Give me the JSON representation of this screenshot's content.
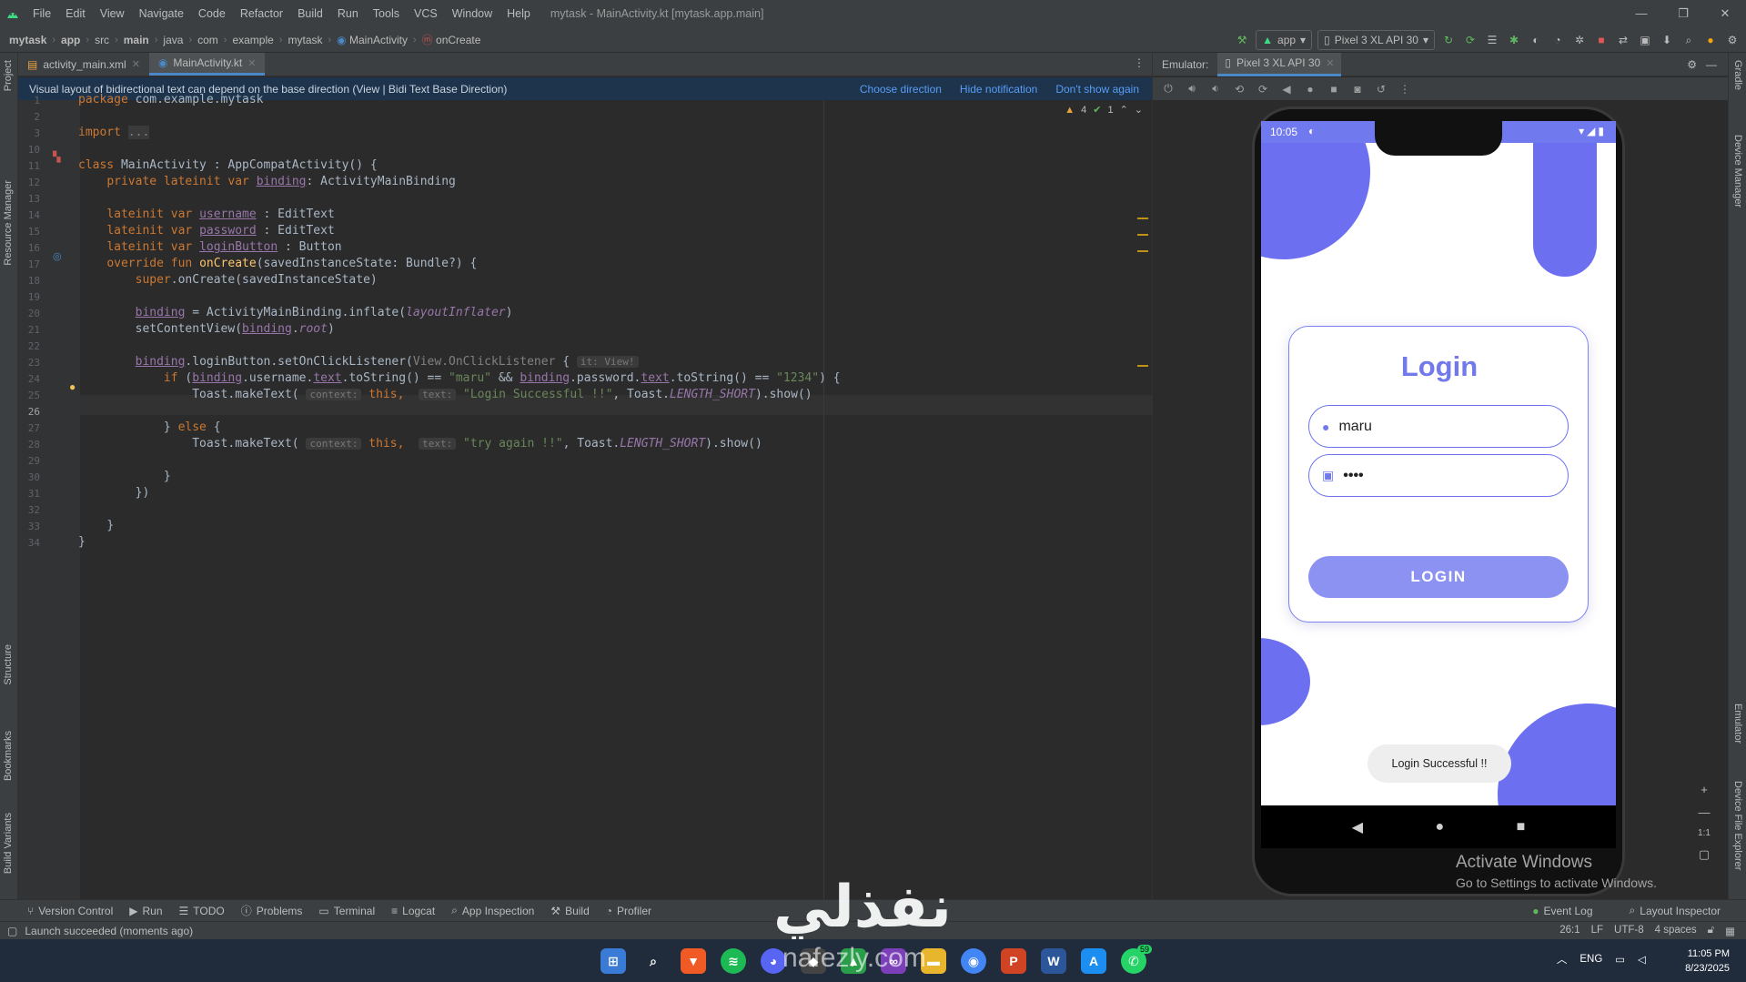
{
  "window": {
    "menu": [
      "File",
      "Edit",
      "View",
      "Navigate",
      "Code",
      "Refactor",
      "Build",
      "Run",
      "Tools",
      "VCS",
      "Window",
      "Help"
    ],
    "title": "mytask - MainActivity.kt [mytask.app.main]",
    "controls": [
      "—",
      "❐",
      "✕"
    ]
  },
  "breadcrumbs": [
    "mytask",
    "app",
    "src",
    "main",
    "java",
    "com",
    "example",
    "mytask",
    "MainActivity",
    "onCreate"
  ],
  "toolbar": {
    "run_config": "app",
    "device": "Pixel 3 XL API 30"
  },
  "left_strip": [
    "Project",
    "Resource Manager",
    "Structure",
    "Bookmarks",
    "Build Variants"
  ],
  "right_strip": [
    "Gradle",
    "Device Manager",
    "Emulator",
    "Device File Explorer"
  ],
  "tabs": [
    {
      "label": "activity_main.xml",
      "active": false
    },
    {
      "label": "MainActivity.kt",
      "active": true
    }
  ],
  "notification": {
    "text": "Visual layout of bidirectional text can depend on the base direction (View | Bidi Text Base Direction)",
    "links": [
      "Choose direction",
      "Hide notification",
      "Don't show again"
    ]
  },
  "inspections": {
    "warnings": "4",
    "ok": "1"
  },
  "code": {
    "line_numbers": [
      "1",
      "2",
      "3",
      "10",
      "11",
      "12",
      "13",
      "14",
      "15",
      "16",
      "17",
      "18",
      "19",
      "20",
      "21",
      "22",
      "23",
      "24",
      "25",
      "26",
      "27",
      "28",
      "29",
      "30",
      "31",
      "32",
      "33",
      "34"
    ],
    "l1a": "package",
    "l1b": " com.example.mytask",
    "l3a": "import",
    "l3b": "...",
    "l10a": "class",
    "l10b": " MainActivity : AppCompatActivity() {",
    "l11a": "private lateinit var",
    "l11b": "binding",
    "l11c": ": ActivityMainBinding",
    "l13a": "lateinit var",
    "l13b": "username",
    "l13c": " : EditText",
    "l14a": "lateinit var",
    "l14b": "password",
    "l14c": " : EditText",
    "l15a": "lateinit var",
    "l15b": "loginButton",
    "l15c": " : Button",
    "l16a": "override fun",
    "l16b": "onCreate",
    "l16c": "(savedInstanceState: Bundle?) {",
    "l17a": "super",
    "l17b": ".onCreate(savedInstanceState)",
    "l19a": "binding",
    "l19b": " = ActivityMainBinding.inflate(",
    "l19c": "layoutInflater",
    "l19d": ")",
    "l20a": "setContentView(",
    "l20b": "binding",
    "l20c": ".",
    "l20d": "root",
    "l20e": ")",
    "l22a": "binding",
    "l22b": ".loginButton.setOnClickListener(",
    "l22c": "View.OnClickListener",
    "l22d": " { ",
    "l22e": "it: View!",
    "l23a": "if",
    "l23b": " (",
    "l23c": "binding",
    "l23d": ".username.",
    "l23e": "text",
    "l23f": ".toString() == ",
    "l23g": "\"maru\"",
    "l23h": " && ",
    "l23i": "binding",
    "l23j": ".password.",
    "l23k": "text",
    "l23l": ".toString() == ",
    "l23m": "\"1234\"",
    "l23n": ") {",
    "l24a": "Toast.makeText( ",
    "l24b": "context:",
    "l24c": " this",
    "l24d": ",  ",
    "l24e": "text:",
    "l24f": " \"Login Successful !!\"",
    "l24g": ", Toast.",
    "l24h": "LENGTH_SHORT",
    "l24i": ").show()",
    "l26a": "} ",
    "l26b": "else",
    "l26c": " {",
    "l27a": "Toast.makeText( ",
    "l27b": "context:",
    "l27c": " this",
    "l27d": ",  ",
    "l27e": "text:",
    "l27f": " \"try again !!\"",
    "l27g": ", Toast.",
    "l27h": "LENGTH_SHORT",
    "l27i": ").show()",
    "l29": "}",
    "l30": "})",
    "l32": "}",
    "l33": "}"
  },
  "emulator": {
    "label": "Emulator:",
    "tab": "Pixel 3 XL API 30",
    "time": "10:05",
    "app": {
      "title": "Login",
      "username": "maru",
      "password": "••••",
      "button": "LOGIN",
      "toast": "Login Successful !!"
    },
    "zoom_label": "1:1"
  },
  "activate": {
    "line1": "Activate Windows",
    "line2": "Go to Settings to activate Windows."
  },
  "bottom_tools": [
    "Version Control",
    "Run",
    "TODO",
    "Problems",
    "Terminal",
    "Logcat",
    "App Inspection",
    "Build",
    "Profiler"
  ],
  "bottom_right_tools": [
    "Event Log",
    "Layout Inspector"
  ],
  "status": {
    "message": "Launch succeeded (moments ago)",
    "position": "26:1",
    "line_sep": "LF",
    "encoding": "UTF-8",
    "indent": "4 spaces"
  },
  "taskbar": {
    "lang": "ENG",
    "time": "11:05 PM",
    "date": "8/23/2025",
    "badge": "59"
  },
  "watermark": {
    "arabic": "نفذلي",
    "latin": "nafezly.com"
  },
  "colors": {
    "accent": "#4a88c7",
    "app_primary": "#7279ea",
    "notice_bg": "#1e344d"
  }
}
